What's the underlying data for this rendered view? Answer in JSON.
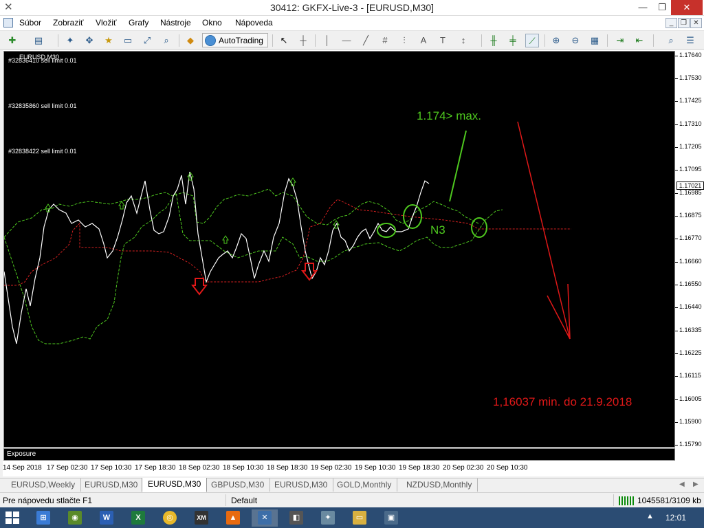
{
  "window": {
    "title": "30412: GKFX-Live-3 - [EURUSD,M30]",
    "min_glyph": "—",
    "max_glyph": "❐",
    "close_glyph": "✕",
    "app_glyph": "✕"
  },
  "menu": {
    "items": [
      "Súbor",
      "Zobraziť",
      "Vložiť",
      "Grafy",
      "Nástroje",
      "Okno",
      "Nápoveda"
    ],
    "mdi": [
      "_",
      "❐",
      "✕"
    ]
  },
  "toolbar": {
    "autotrading_label": "AutoTrading",
    "glyphs": {
      "new-chart-icon": "✚",
      "profiles-icon": "▤",
      "market-watch-icon": "✦",
      "navigator-icon": "✥",
      "favorites-icon": "★",
      "data-window-icon": "▭",
      "terminal-icon": "⤢",
      "tester-icon": "⌕",
      "new-order-icon": "◆",
      "cursor-icon": "↖",
      "crosshair-icon": "┼",
      "vertical-line-icon": "│",
      "horizontal-line-icon": "—",
      "trendline-icon": "╱",
      "channel-icon": "#",
      "fibo-icon": "⫶",
      "text-icon": "A",
      "text-label-icon": "T",
      "arrows-icon": "↕",
      "bar-chart-icon": "╫",
      "candle-chart-icon": "╪",
      "line-chart-icon": "⟋",
      "zoom-in-icon": "⊕",
      "zoom-out-icon": "⊖",
      "tile-windows-icon": "▦",
      "autoscroll-icon": "⇥",
      "chart-shift-icon": "⇤",
      "search-icon": "⌕",
      "options-icon": "☰"
    }
  },
  "chart": {
    "symbol_label": "EURUSD,M30",
    "orders": [
      "#32836410 sell limit 0.01",
      "#32835860 sell limit 0.01",
      "#32838422 sell limit 0.01"
    ],
    "annotations": {
      "max_text": "1.174> max.",
      "n3_text": "N3",
      "min_text": "1,16037 min. do 21.9.2018"
    },
    "colors": {
      "price_line": "#ffffff",
      "green_line": "#4ec81f",
      "red_line": "#d42020",
      "background": "#000000"
    },
    "price_ticks": [
      "1.17640",
      "1.17530",
      "1.17425",
      "1.17310",
      "1.17205",
      "1.17095",
      "1.16985",
      "1.16875",
      "1.16770",
      "1.16660",
      "1.16550",
      "1.16440",
      "1.16335",
      "1.16225",
      "1.16115",
      "1.16005",
      "1.15900",
      "1.15790"
    ],
    "current_price": "1.17021",
    "time_ticks": [
      "14 Sep 2018",
      "17 Sep 02:30",
      "17 Sep 10:30",
      "17 Sep 18:30",
      "18 Sep 02:30",
      "18 Sep 10:30",
      "18 Sep 18:30",
      "19 Sep 02:30",
      "19 Sep 10:30",
      "19 Sep 18:30",
      "20 Sep 02:30",
      "20 Sep 10:30"
    ],
    "exposure_label": "Exposure"
  },
  "tabs": {
    "items": [
      "EURUSD,Weekly",
      "EURUSD,M30",
      "EURUSD,M30",
      "GBPUSD,M30",
      "EURUSD,M30",
      "GOLD,Monthly",
      "NZDUSD,Monthly"
    ],
    "active_index": 2
  },
  "status": {
    "help": "Pre nápovedu stlačte F1",
    "profile": "Default",
    "traffic": "1045581/3109 kb"
  },
  "taskbar": {
    "apps": [
      "⊞",
      "◉",
      "W",
      "X",
      "◎",
      "XM",
      "▲",
      "✕",
      "◧",
      "✦",
      "▭",
      "▣"
    ],
    "app_colors": [
      "#3a7bd5",
      "#5a8a2a",
      "#2b5fb3",
      "#1e7a3c",
      "#e8b82a",
      "#333333",
      "#e86a10",
      "#3d6ea8",
      "#555555",
      "#6a8aa0",
      "#d8b040",
      "#4a6a8a"
    ],
    "active_index": 7,
    "clock": "12:01",
    "tray_glyph": "▲"
  }
}
